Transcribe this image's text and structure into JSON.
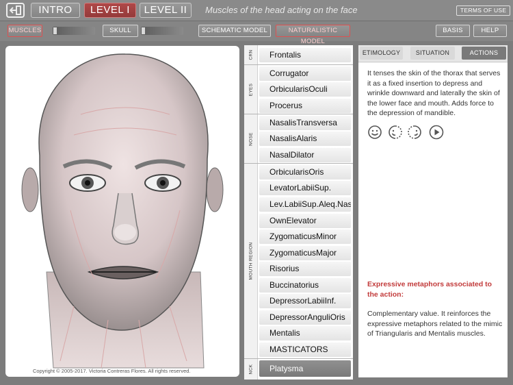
{
  "topbar": {
    "tabs": [
      "INTRO",
      "LEVEL I",
      "LEVEL II"
    ],
    "title": "Muscles of the head acting on the face",
    "terms_label": "TERMS OF USE"
  },
  "toolbar": {
    "muscles_label": "MUSCLES",
    "skull_label": "SKULL",
    "schematic_label": "SCHEMATIC MODEL",
    "naturalistic_label": "NATURALISTIC MODEL",
    "basis_label": "BASIS",
    "help_label": "HELP"
  },
  "image": {
    "copyright": "Copyright © 2005-2017. Victoria Contreras Flores. All rights reserved."
  },
  "muscle_groups": [
    {
      "label": "CRN",
      "items": [
        "Frontalis"
      ]
    },
    {
      "label": "EYES",
      "items": [
        "Corrugator",
        "OrbicularisOculi",
        "Procerus"
      ]
    },
    {
      "label": "NOSE",
      "items": [
        "NasalisTransversa",
        "NasalisAlaris",
        "NasalDilator"
      ]
    },
    {
      "label": "MOUTH REGION",
      "items": [
        "OrbicularisOris",
        "LevatorLabiiSup.",
        "Lev.LabiiSup.Aleq.Nasi",
        "OwnElevator",
        "ZygomaticusMinor",
        "ZygomaticusMajor",
        "Risorius",
        "Buccinatorius",
        "DepressorLabiiInf.",
        "DepressorAnguliOris",
        "Mentalis",
        "MASTICATORS"
      ]
    },
    {
      "label": "NCK",
      "items": [
        "Platysma"
      ]
    }
  ],
  "selected_muscle": "Platysma",
  "info": {
    "tabs": [
      "ETIMOLOGY",
      "SITUATION",
      "ACTIONS"
    ],
    "active_tab": "ACTIONS",
    "description": "It tenses the skin of the thorax that serves it as a fixed insertion to depress and wrinkle downward and laterally the skin of the lower face and mouth. Adds force to the depression of mandible.",
    "icons": [
      "face-full-icon",
      "face-left-icon",
      "face-right-icon",
      "play-icon"
    ],
    "metaphors_title": "Expressive metaphors associated to the action:",
    "metaphors_text": "Complementary value. It reinforces the expressive metaphors related to the mimic of Triangularis and Mentalis muscles."
  },
  "colors": {
    "accent_red": "#c23b3b",
    "active_tab": "#943a3a",
    "selected_item": "#808080"
  }
}
